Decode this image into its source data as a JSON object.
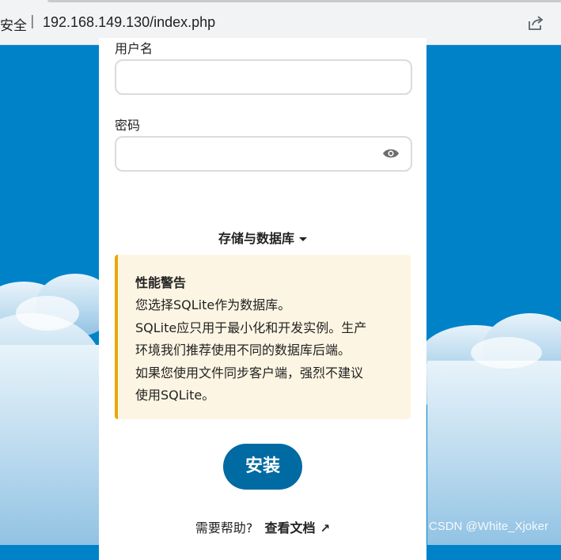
{
  "browser": {
    "security_label": "安全",
    "separator": "|",
    "url": "192.168.149.130/index.php",
    "share_icon": "share-icon"
  },
  "form": {
    "username_label": "用户名",
    "username_value": "",
    "password_label": "密码",
    "password_value": "",
    "password_toggle_icon": "eye-icon",
    "storage_toggle_label": "存储与数据库",
    "warning": {
      "title": "性能警告",
      "lines": [
        "您选择SQLite作为数据库。",
        "SQLite应只用于最小化和开发实例。生产",
        "环境我们推荐使用不同的数据库后端。",
        "如果您使用文件同步客户端，强烈不建议",
        "使用SQLite。"
      ]
    },
    "install_button": "安装",
    "help_text": "需要帮助?",
    "docs_link": "查看文档",
    "docs_link_arrow": "↗"
  },
  "watermark": "CSDN @White_Xjoker",
  "colors": {
    "background_blue": "#0082c9",
    "install_button": "#006aa3",
    "warning_bg": "#fdf5e3",
    "warning_border": "#e9a800"
  }
}
